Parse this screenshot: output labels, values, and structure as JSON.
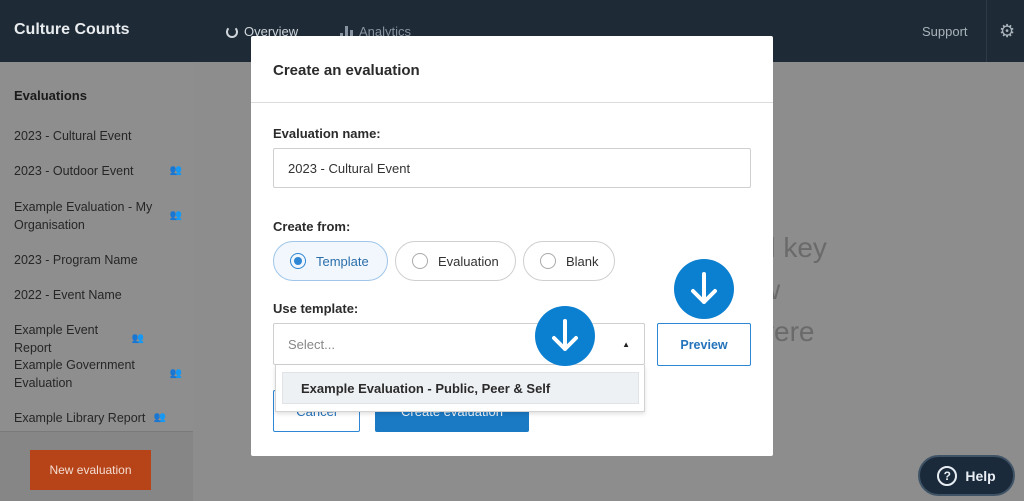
{
  "topbar": {
    "brand": "Culture Counts",
    "nav_overview": "Overview",
    "nav_analytics": "Analytics",
    "support": "Support"
  },
  "sidebar": {
    "heading": "Evaluations",
    "items": [
      {
        "label": "2023 - Cultural Event",
        "shared": false
      },
      {
        "label": "2023 - Outdoor Event",
        "shared": true
      },
      {
        "label": "Example Evaluation - My Organisation",
        "shared": true
      },
      {
        "label": "2023 - Program Name",
        "shared": false
      },
      {
        "label": "2022 - Event Name",
        "shared": false
      },
      {
        "label": "Example Event Report",
        "shared": true
      },
      {
        "label": "Example Government Evaluation",
        "shared": true
      },
      {
        "label": "Example Library Report",
        "shared": true
      }
    ],
    "new_button": "New evaluation"
  },
  "background_text": {
    "line1": "d key",
    "line2": "w",
    "line3": "vere"
  },
  "modal": {
    "title": "Create an evaluation",
    "name_label": "Evaluation name:",
    "name_value": "2023 - Cultural Event",
    "create_from_label": "Create from:",
    "options": {
      "template": "Template",
      "evaluation": "Evaluation",
      "blank": "Blank"
    },
    "selected_option": "Template",
    "template_label": "Use template:",
    "select_placeholder": "Select...",
    "preview_button": "Preview",
    "cancel_button": "Cancel",
    "create_button": "Create evaluation",
    "dropdown_option": "Example Evaluation - Public, Peer & Self"
  },
  "help_button": "Help",
  "colors": {
    "topbar": "#1e2a35",
    "accent_blue": "#0b7fd0",
    "new_button": "#b64418",
    "help_button": "#1b2a3a"
  }
}
